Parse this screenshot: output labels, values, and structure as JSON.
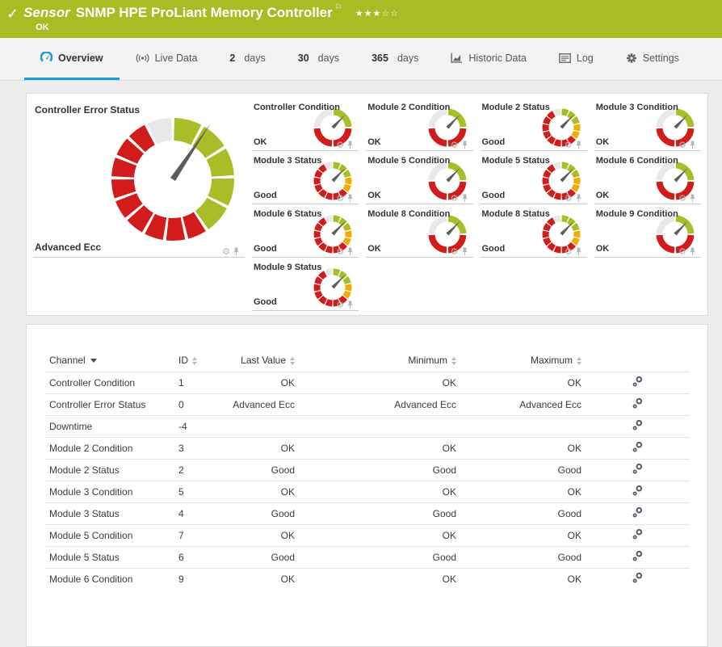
{
  "colors": {
    "header_green": "#a9bc23",
    "accent_blue": "#1d9ad2",
    "gauge_red": "#d21c1c",
    "gauge_green": "#a9bd28",
    "gauge_yellow": "#f2ab00",
    "gauge_gray": "#e8e8e8"
  },
  "icons": {
    "check": "✓",
    "flag": "⚐",
    "star_filled": "★",
    "star_empty": "☆",
    "gear": "⚙"
  },
  "header": {
    "kind_label": "Sensor",
    "title": "SNMP HPE ProLiant Memory Controller",
    "status": "OK",
    "rating": {
      "filled": 3,
      "total": 5
    }
  },
  "tabs": [
    {
      "label": "Overview",
      "icon": "gauge",
      "active": true
    },
    {
      "label": "Live Data",
      "icon": "live",
      "active": false
    },
    {
      "strong": "2",
      "rest": "days",
      "active": false
    },
    {
      "strong": "30",
      "rest": "days",
      "active": false
    },
    {
      "strong": "365",
      "rest": "days",
      "active": false
    },
    {
      "label": "Historic Data",
      "icon": "chart",
      "active": false
    },
    {
      "label": "Log",
      "icon": "log",
      "active": false
    },
    {
      "label": "Settings",
      "icon": "gear",
      "active": false
    }
  ],
  "overview": {
    "large_tile": {
      "title": "Controller Error Status",
      "value": "Advanced Ecc",
      "gauge": "large"
    },
    "tiles": [
      {
        "title": "Controller Condition",
        "value": "OK",
        "gauge": "condition"
      },
      {
        "title": "Module 2 Condition",
        "value": "OK",
        "gauge": "condition"
      },
      {
        "title": "Module 2 Status",
        "value": "Good",
        "gauge": "status"
      },
      {
        "title": "Module 3 Condition",
        "value": "OK",
        "gauge": "condition"
      },
      {
        "title": "Module 3 Status",
        "value": "Good",
        "gauge": "status"
      },
      {
        "title": "Module 5 Condition",
        "value": "OK",
        "gauge": "condition"
      },
      {
        "title": "Module 5 Status",
        "value": "Good",
        "gauge": "status"
      },
      {
        "title": "Module 6 Condition",
        "value": "OK",
        "gauge": "condition"
      },
      {
        "title": "Module 6 Status",
        "value": "Good",
        "gauge": "status"
      },
      {
        "title": "Module 8 Condition",
        "value": "OK",
        "gauge": "condition"
      },
      {
        "title": "Module 8 Status",
        "value": "Good",
        "gauge": "status"
      },
      {
        "title": "Module 9 Condition",
        "value": "OK",
        "gauge": "condition"
      },
      {
        "title": "Module 9 Status",
        "value": "Good",
        "gauge": "status"
      }
    ]
  },
  "table": {
    "columns": [
      {
        "label": "Channel",
        "sorted": true,
        "align": "al"
      },
      {
        "label": "ID",
        "sorted": false,
        "align": "al"
      },
      {
        "label": "Last Value",
        "sorted": false,
        "align": "ar"
      },
      {
        "label": "Minimum",
        "sorted": false,
        "align": "ar"
      },
      {
        "label": "Maximum",
        "sorted": false,
        "align": "ar"
      }
    ],
    "rows": [
      {
        "channel": "Controller Condition",
        "id": "1",
        "last": "OK",
        "min": "OK",
        "max": "OK"
      },
      {
        "channel": "Controller Error Status",
        "id": "0",
        "last": "Advanced Ecc",
        "min": "Advanced Ecc",
        "max": "Advanced Ecc"
      },
      {
        "channel": "Downtime",
        "id": "-4",
        "last": "",
        "min": "",
        "max": ""
      },
      {
        "channel": "Module 2 Condition",
        "id": "3",
        "last": "OK",
        "min": "OK",
        "max": "OK"
      },
      {
        "channel": "Module 2 Status",
        "id": "2",
        "last": "Good",
        "min": "Good",
        "max": "Good"
      },
      {
        "channel": "Module 3 Condition",
        "id": "5",
        "last": "OK",
        "min": "OK",
        "max": "OK"
      },
      {
        "channel": "Module 3 Status",
        "id": "4",
        "last": "Good",
        "min": "Good",
        "max": "Good"
      },
      {
        "channel": "Module 5 Condition",
        "id": "7",
        "last": "OK",
        "min": "OK",
        "max": "OK"
      },
      {
        "channel": "Module 5 Status",
        "id": "6",
        "last": "Good",
        "min": "Good",
        "max": "Good"
      },
      {
        "channel": "Module 6 Condition",
        "id": "9",
        "last": "OK",
        "min": "OK",
        "max": "OK"
      }
    ]
  }
}
